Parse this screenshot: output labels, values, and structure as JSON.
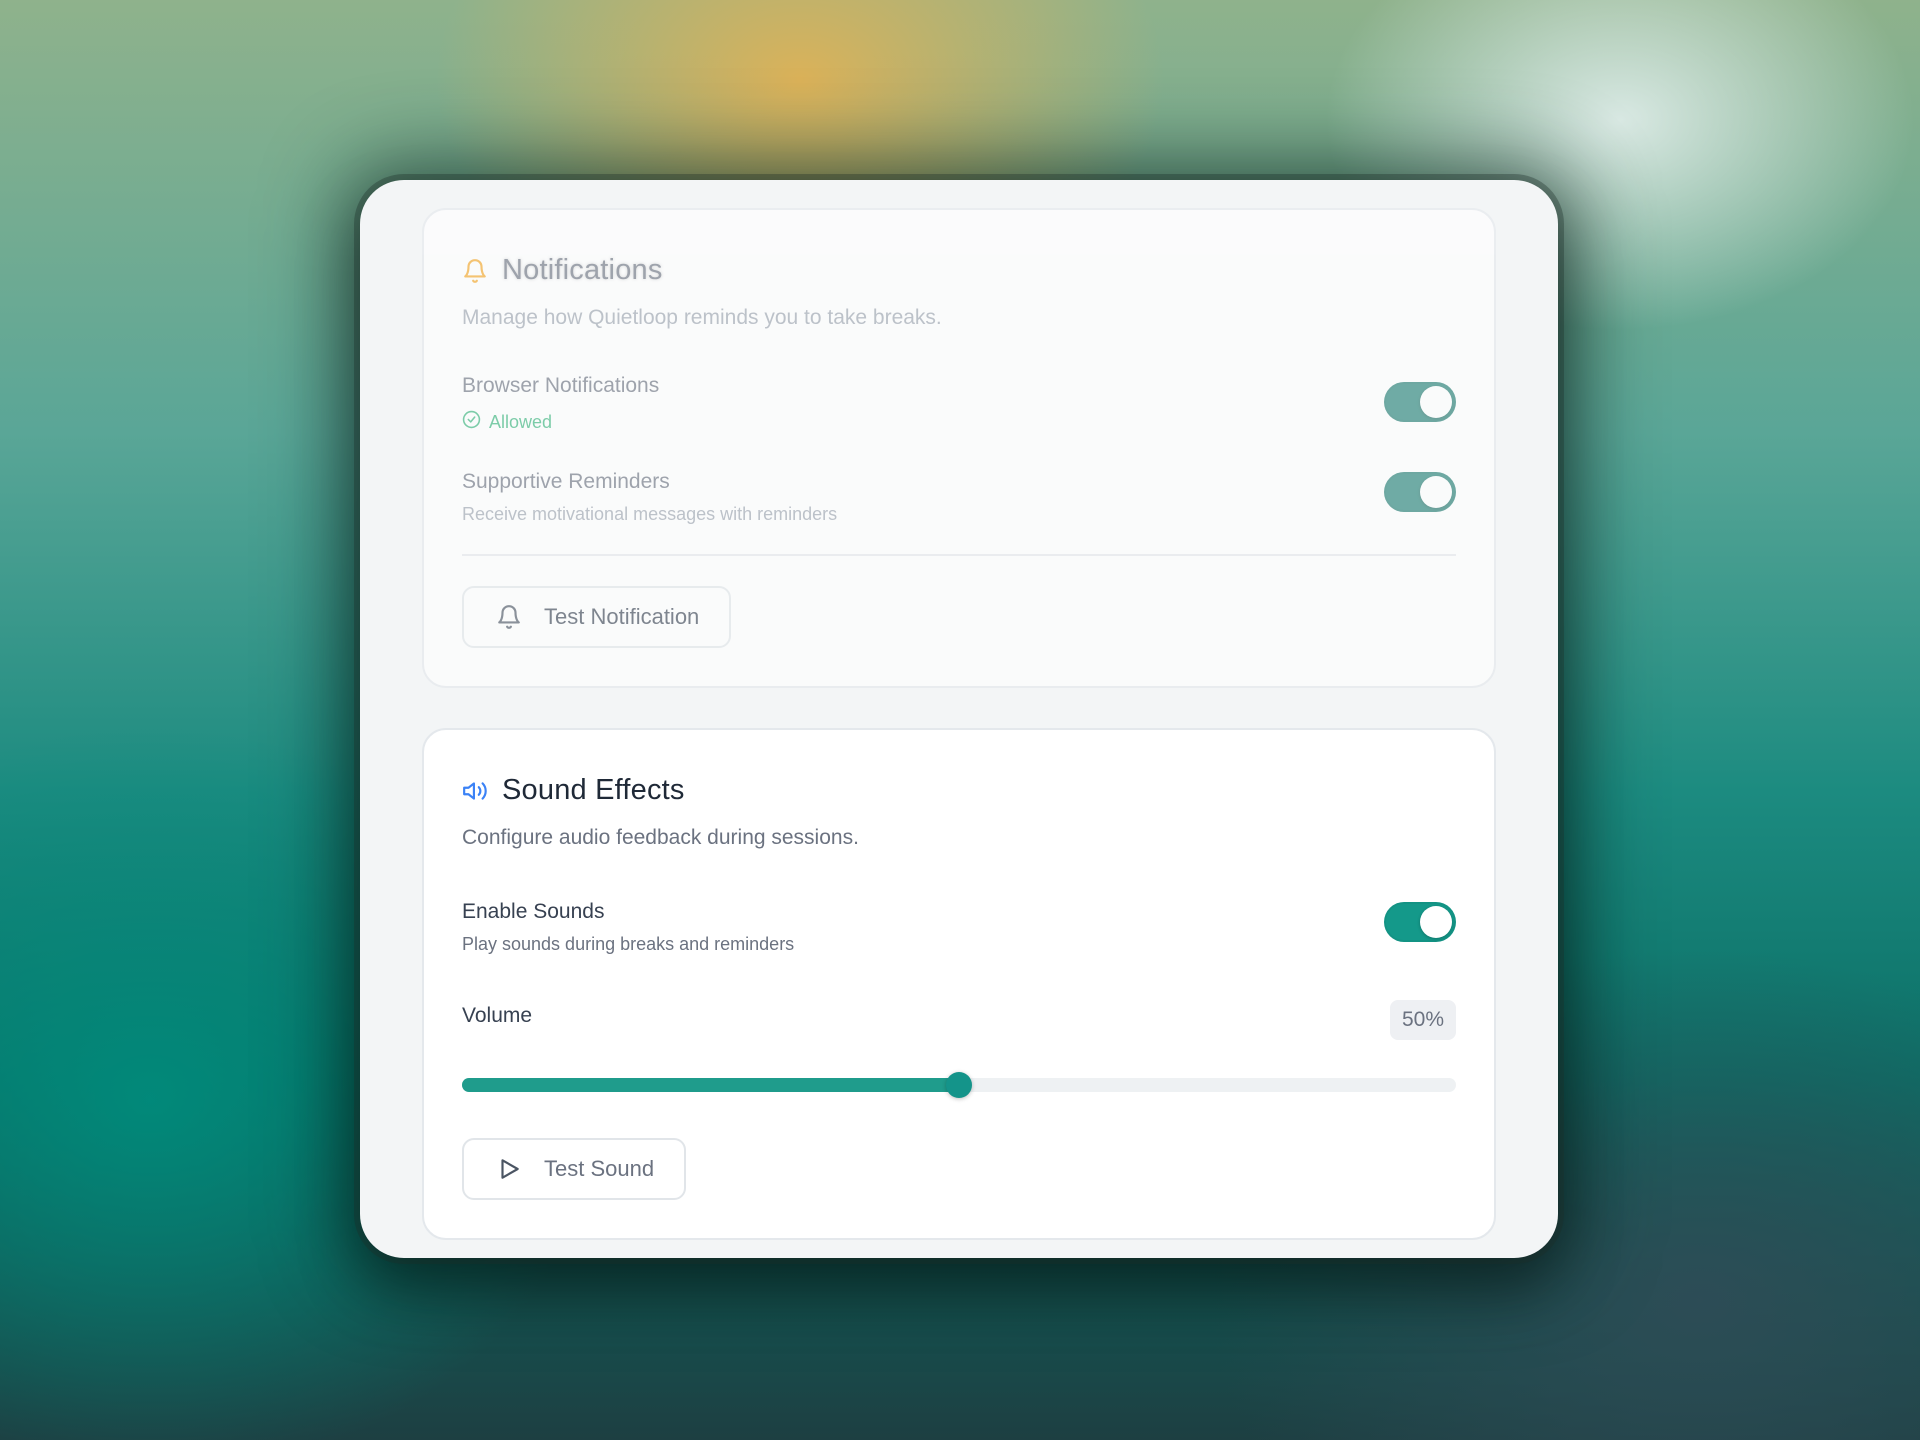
{
  "colors": {
    "accent": "#14998a",
    "success": "#34b37a",
    "notification_icon": "#f5a623",
    "sound_icon": "#3b82f6"
  },
  "notifications": {
    "title": "Notifications",
    "icon": "bell-icon",
    "description": "Manage how Quietloop reminds you to take breaks.",
    "browser_notifications": {
      "label": "Browser Notifications",
      "status": "Allowed",
      "enabled": true
    },
    "supportive_reminders": {
      "label": "Supportive Reminders",
      "sub": "Receive motivational messages with reminders",
      "enabled": true
    },
    "test_button": "Test Notification"
  },
  "sound": {
    "title": "Sound Effects",
    "icon": "speaker-icon",
    "description": "Configure audio feedback during sessions.",
    "enable_sounds": {
      "label": "Enable Sounds",
      "sub": "Play sounds during breaks and reminders",
      "enabled": true
    },
    "volume": {
      "label": "Volume",
      "value_text": "50%",
      "value": 0.5
    },
    "test_button": "Test Sound"
  }
}
